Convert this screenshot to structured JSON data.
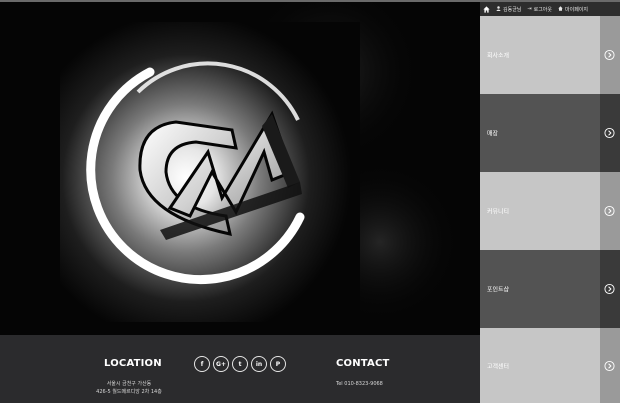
{
  "topbar": {
    "home_icon": "home-icon",
    "user_label": "김동균님",
    "logout_label": "로그아웃",
    "mypage_label": "마이페이지"
  },
  "hero": {
    "logo_text": "CM",
    "background": "#050505",
    "ring_color": "#ffffff"
  },
  "menu": {
    "items": [
      {
        "label": "회사소개",
        "icon": "chevron-right-circle-icon",
        "tone": "light"
      },
      {
        "label": "매장",
        "icon": "chevron-right-circle-icon",
        "tone": "dark"
      },
      {
        "label": "커뮤니티",
        "icon": "chevron-right-circle-icon",
        "tone": "light"
      },
      {
        "label": "포인트샵",
        "icon": "chevron-right-circle-icon",
        "tone": "dark"
      },
      {
        "label": "고객센터",
        "icon": "chevron-right-circle-icon",
        "tone": "light"
      }
    ]
  },
  "footer": {
    "location_heading": "LOCATION",
    "address_line1": "서울시 금천구 가산동",
    "address_line2": "426-5 월드메르디앙 2차 14층",
    "contact_heading": "CONTACT",
    "tel": "Tel 010-8323-9068",
    "social": [
      {
        "name": "facebook-icon",
        "glyph": "f"
      },
      {
        "name": "google-plus-icon",
        "glyph": "G+"
      },
      {
        "name": "twitter-icon",
        "glyph": "t"
      },
      {
        "name": "linkedin-icon",
        "glyph": "in"
      },
      {
        "name": "pinterest-icon",
        "glyph": "P"
      }
    ]
  },
  "colors": {
    "footer_bg": "#2b2b2d",
    "menu_light": "#c6c6c6",
    "menu_dark": "#535353",
    "topbar_bg": "#2d2d2d"
  }
}
